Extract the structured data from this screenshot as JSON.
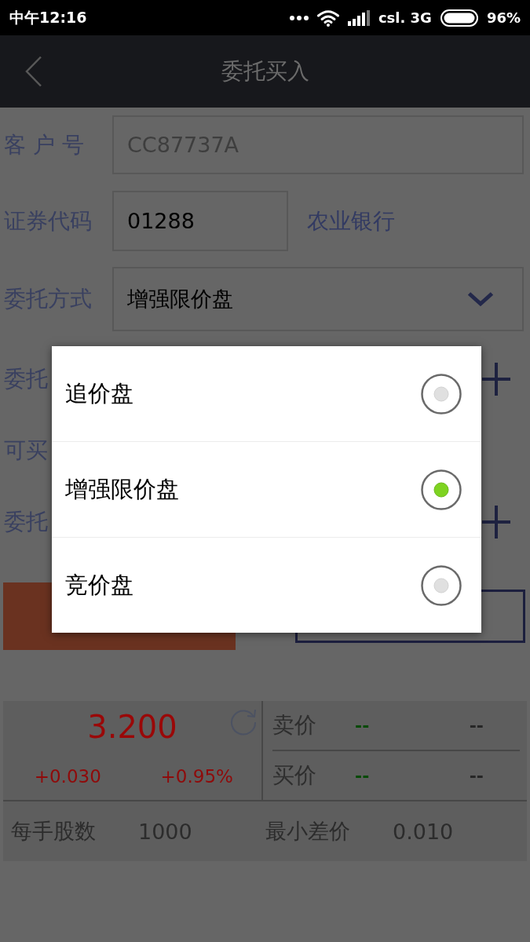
{
  "status_bar": {
    "time": "中午12:16",
    "carrier": "csl. 3G",
    "battery": "96%"
  },
  "app_bar": {
    "title": "委托买入"
  },
  "form": {
    "customer": {
      "label": "客 户 号",
      "value": "CC87737A",
      "disabled": true
    },
    "code": {
      "label": "证券代码",
      "value": "01288",
      "stock_name": "农业银行"
    },
    "order_type": {
      "label": "委托方式",
      "value": "增强限价盘"
    },
    "rows": [
      {
        "label": "委托",
        "kind": "stepper"
      },
      {
        "label": "可买",
        "kind": "text"
      },
      {
        "label": "委托",
        "kind": "stepper"
      }
    ]
  },
  "buttons": [
    {
      "kind": "filled"
    },
    {
      "kind": "outline"
    }
  ],
  "quote": {
    "price": "3.200",
    "change": "+0.030",
    "change_pct": "+0.95%",
    "levels": [
      {
        "label": "卖价",
        "price": "--",
        "volume": "--"
      },
      {
        "label": "买价",
        "price": "--",
        "volume": "--"
      }
    ],
    "lot_label": "每手股数",
    "lot": "1000",
    "tick_label": "最小差价",
    "tick": "0.010"
  },
  "dialog": {
    "options": [
      {
        "label": "追价盘",
        "selected": false
      },
      {
        "label": "增强限价盘",
        "selected": true
      },
      {
        "label": "竞价盘",
        "selected": false
      }
    ]
  }
}
